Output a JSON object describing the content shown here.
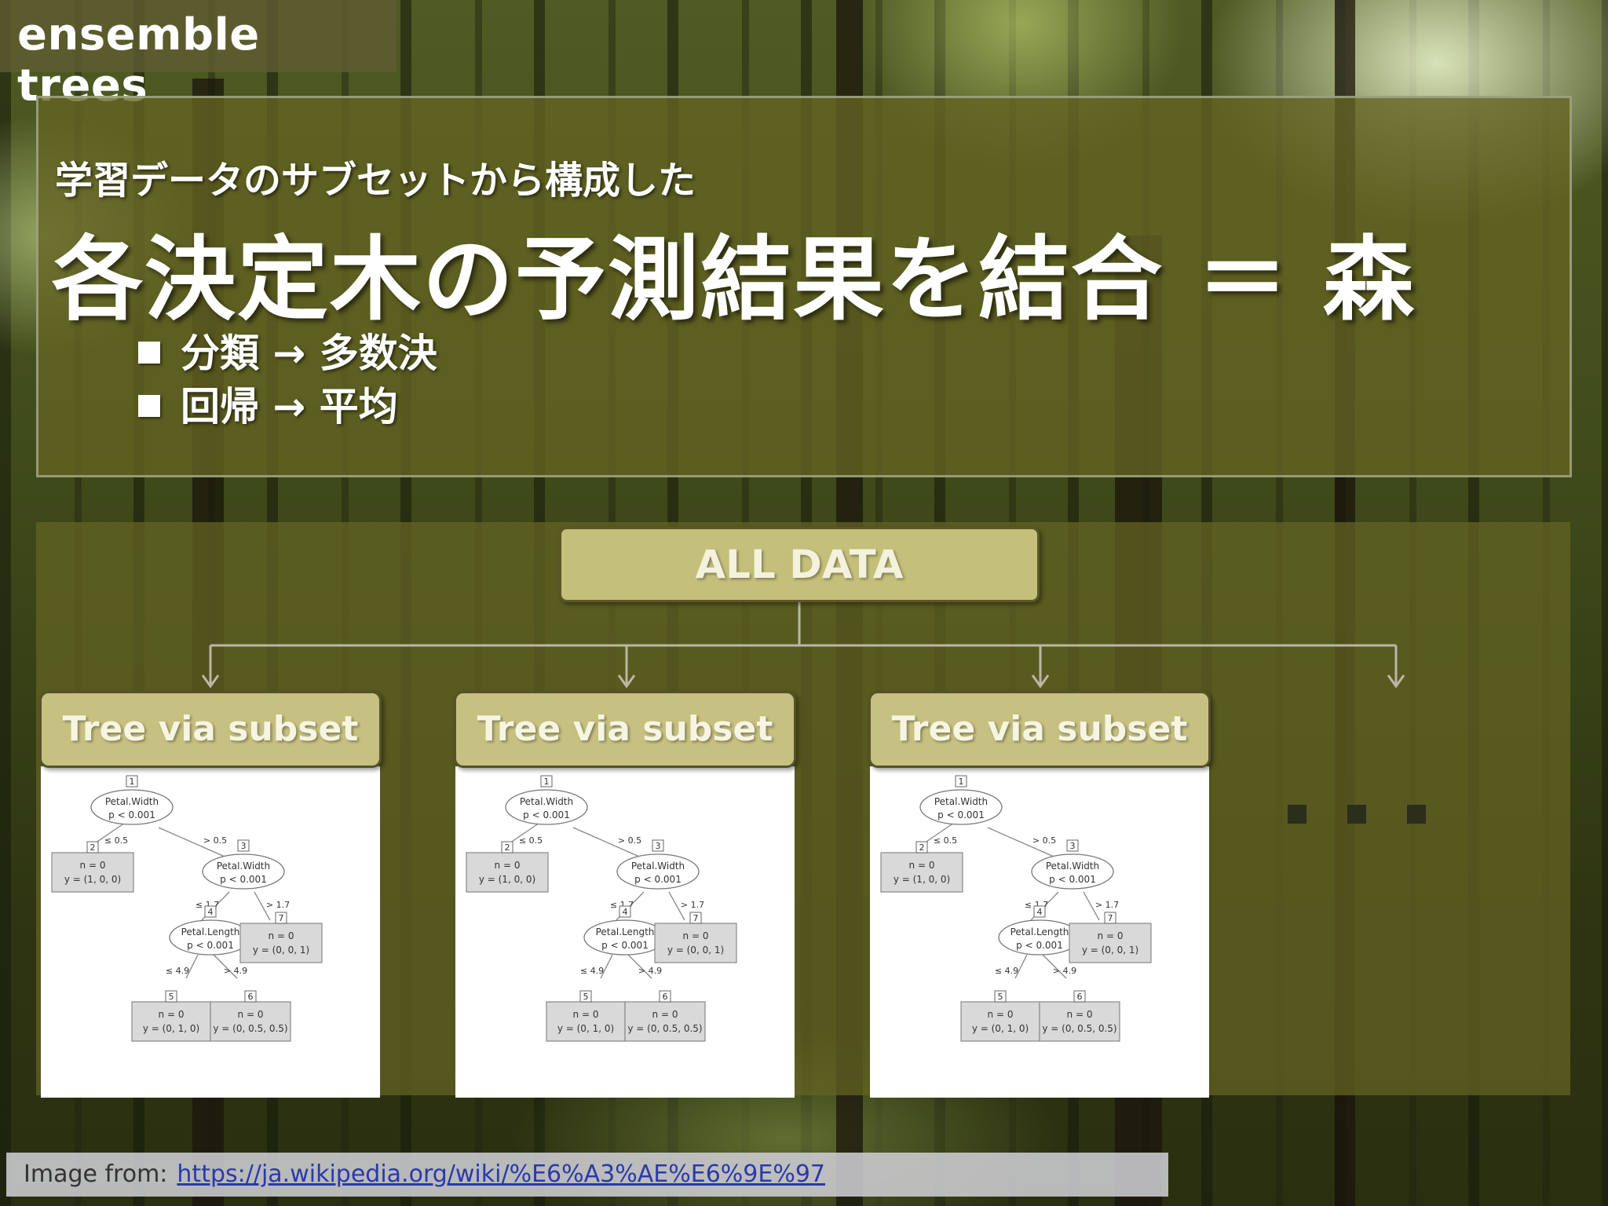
{
  "slide": {
    "section_title": "ensemble trees",
    "subtitle": "学習データのサブセットから構成した",
    "headline": "各決定木の予測結果を結合 ＝ 森",
    "bullets": [
      {
        "text": "分類 → 多数決"
      },
      {
        "text": "回帰 → 平均"
      }
    ]
  },
  "diagram": {
    "root_label": "ALL DATA",
    "tree_label": "Tree via subset",
    "ellipsis": "…",
    "tree": {
      "node1": {
        "id": "1",
        "var": "Petal.Width",
        "p": "p < 0.001"
      },
      "edge1_left": "≤ 0.5",
      "edge1_right": "> 0.5",
      "node2": {
        "id": "2",
        "n": "n = 0",
        "y": "y = (1, 0, 0)"
      },
      "node3": {
        "id": "3",
        "var": "Petal.Width",
        "p": "p < 0.001"
      },
      "edge3_left": "≤ 1.7",
      "edge3_right": "> 1.7",
      "node4": {
        "id": "4",
        "var": "Petal.Length",
        "p": "p < 0.001"
      },
      "node7": {
        "id": "7",
        "n": "n = 0",
        "y": "y = (0, 0, 1)"
      },
      "edge4_left": "≤ 4.9",
      "edge4_right": "> 4.9",
      "node5": {
        "id": "5",
        "n": "n = 0",
        "y": "y = (0, 1, 0)"
      },
      "node6": {
        "id": "6",
        "n": "n = 0",
        "y": "y = (0, 0.5, 0.5)"
      }
    }
  },
  "credit": {
    "prefix": "Image from:",
    "url": "https://ja.wikipedia.org/wiki/%E6%A3%AE%E6%9E%97"
  }
}
